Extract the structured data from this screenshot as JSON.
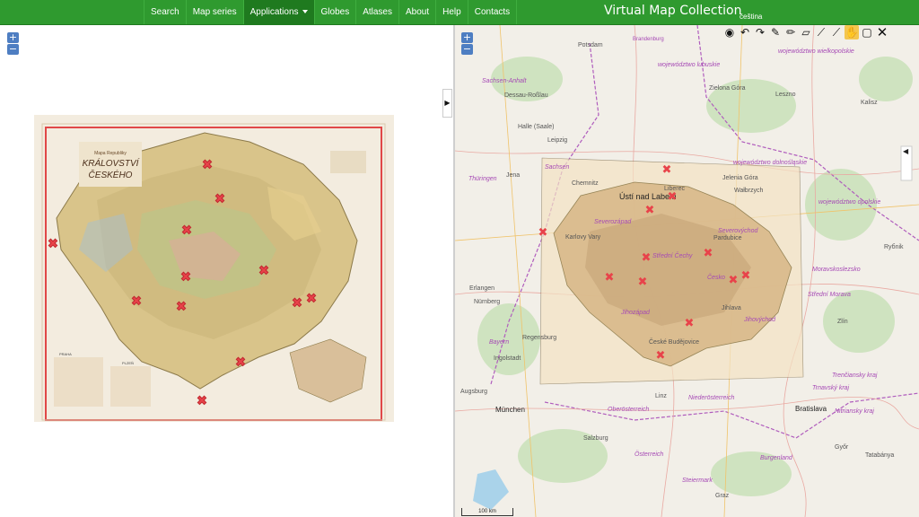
{
  "nav": {
    "items": [
      {
        "label": "Search"
      },
      {
        "label": "Map series"
      },
      {
        "label": "Applications"
      },
      {
        "label": "Globes"
      },
      {
        "label": "Atlases"
      },
      {
        "label": "About"
      },
      {
        "label": "Help"
      },
      {
        "label": "Contacts"
      }
    ],
    "brand": "Virtual Map Collection",
    "language": "čeština"
  },
  "zoom": {
    "in": "+",
    "out": "−"
  },
  "toggles": {
    "left": "▶",
    "right": "◀",
    "edge": "◀"
  },
  "scale_label": "100 km",
  "scan": {
    "title_line1": "Mapa Republiky",
    "title_line2": "KRÁLOVSTVÍ",
    "title_line3": "ČESKÉHO",
    "inset_left": "PRAHA",
    "inset_left2": "PLZEŇ"
  },
  "map_labels": {
    "places": [
      "Potsdam",
      "Brandenburg",
      "Zielona Góra",
      "Leszno",
      "Kalisz",
      "Dessau-Roßlau",
      "Halle (Saale)",
      "Leipzig",
      "Jena",
      "Chemnitz",
      "Ústí nad Labem",
      "Liberec",
      "Jelenia Góra",
      "Wałbrzych",
      "Karlovy Vary",
      "Pardubice",
      "Erlangen",
      "Nürnberg",
      "Regensburg",
      "Ingolstadt",
      "Augsburg",
      "München",
      "České Budějovice",
      "Jihlava",
      "Linz",
      "Salzburg",
      "Bratislava",
      "Zlín",
      "Győr",
      "Tatabánya",
      "Graz",
      "Ryбnik"
    ],
    "regions": [
      "województwo lubuskie",
      "województwo wielkopolskie",
      "Sachsen-Anhalt",
      "Sachsen",
      "Thüringen",
      "województwo dolnośląskie",
      "województwo opolskie",
      "Severozápad",
      "Severovýchod",
      "Střední Čechy",
      "Česko",
      "Jihozápad",
      "Jihovýchod",
      "Moravskoslezsko",
      "Střední Morava",
      "Bayern",
      "Niederösterreich",
      "Oberösterreich",
      "Österreich",
      "Burgenland",
      "Steiermark",
      "Trenčiansky kraj",
      "Trnavský kraj",
      "Nitriansky kraj"
    ]
  },
  "toolbar": [
    "globe-icon",
    "undo-icon",
    "redo-icon",
    "edit-icon",
    "pencil-icon",
    "polygon-icon",
    "measure-icon",
    "measure-area-icon",
    "pan-hand-icon",
    "layers-icon",
    "close-icon"
  ],
  "colors": {
    "nav_bg": "#2f9a2f",
    "nav_active": "#1f7a1f",
    "marker": "#e8434a",
    "zoom_btn": "#4e7ec2"
  }
}
